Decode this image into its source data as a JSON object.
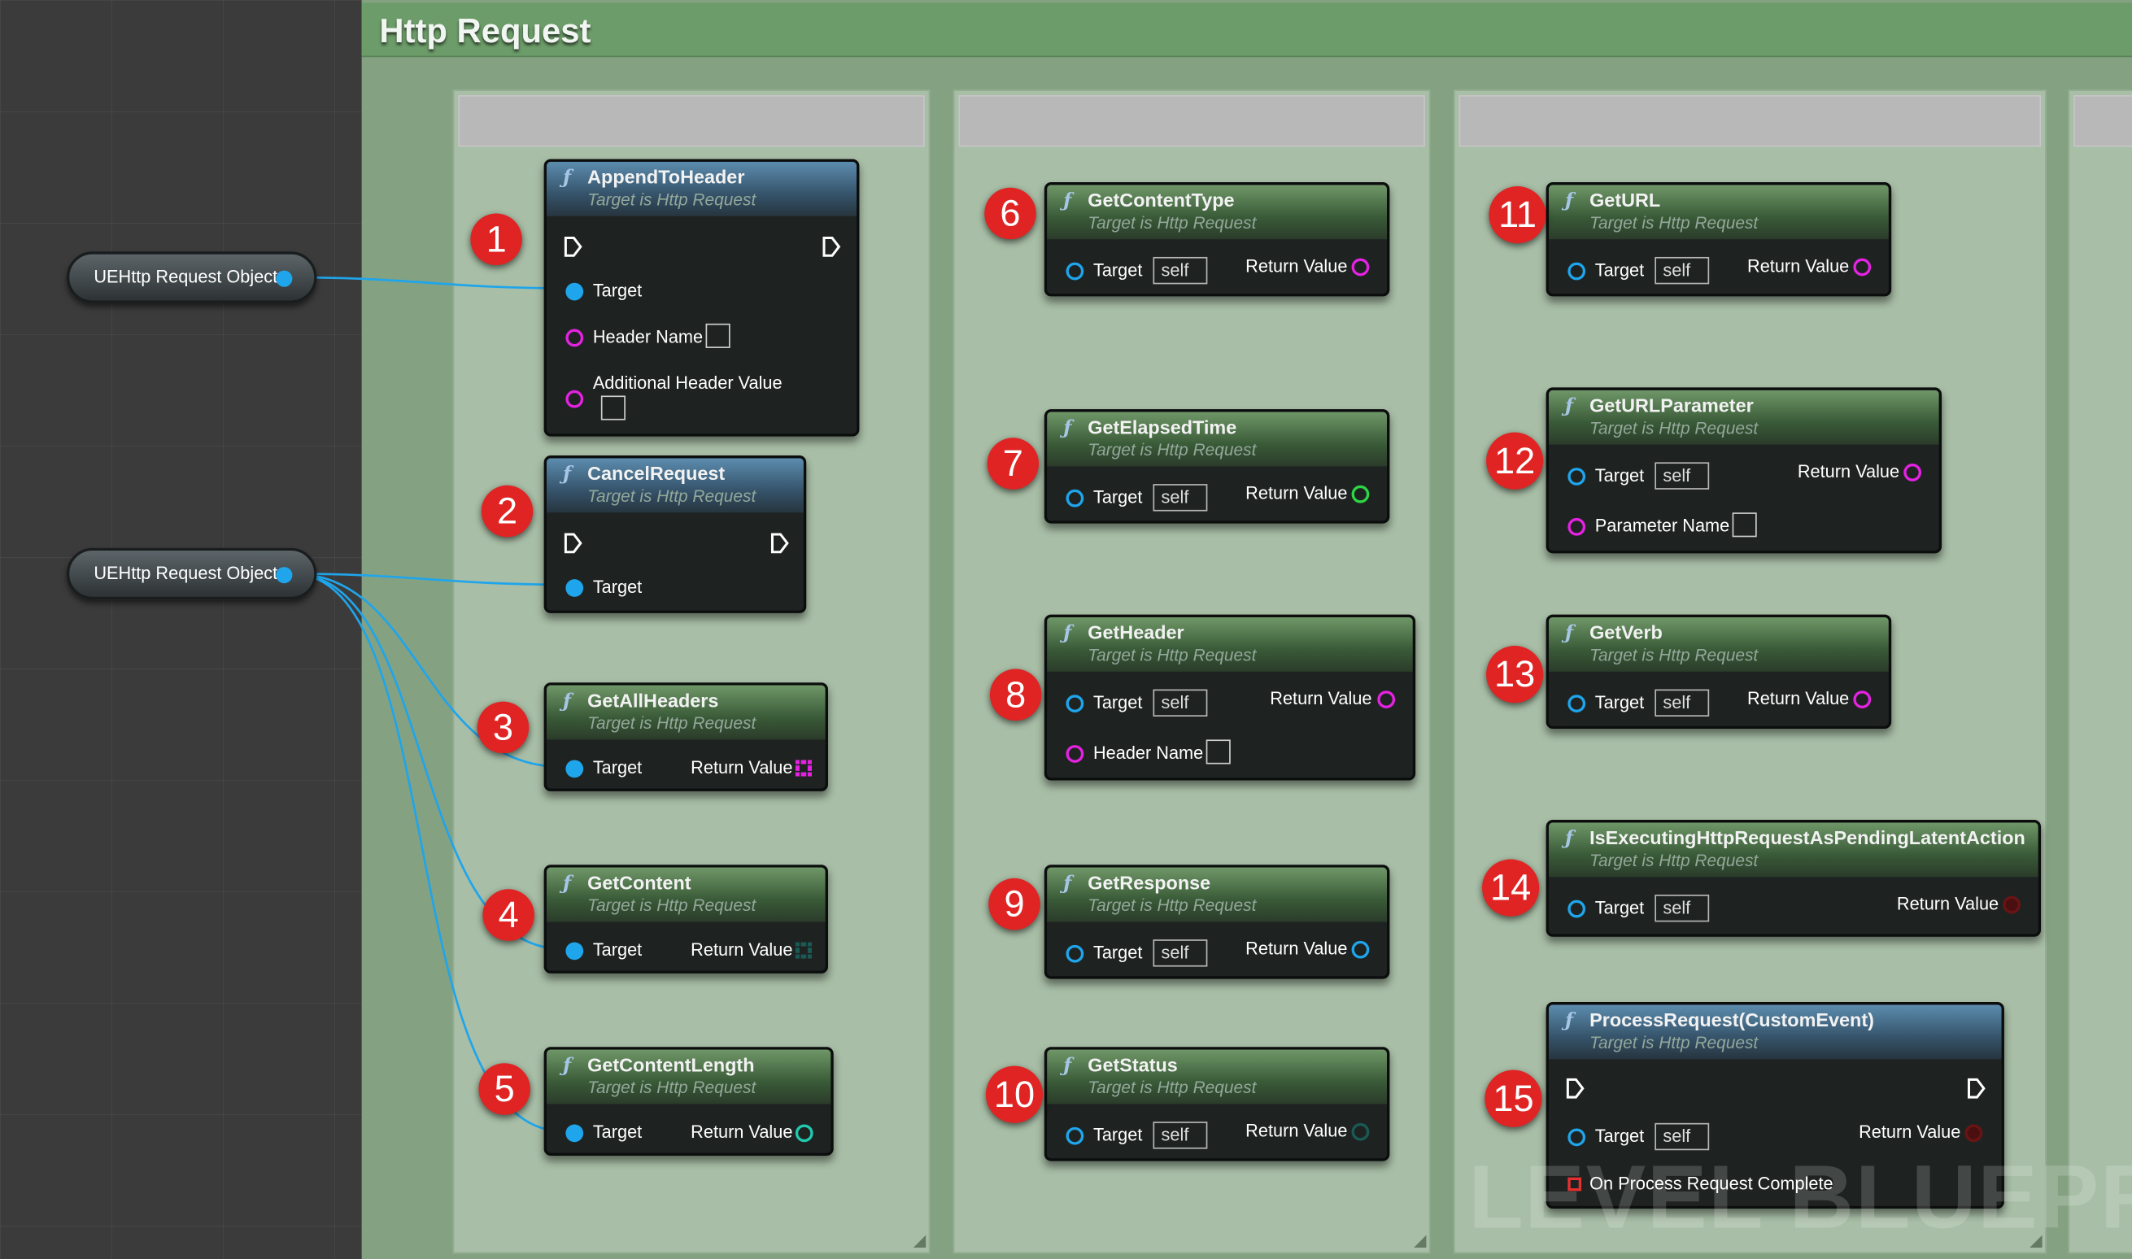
{
  "comment": {
    "title": "Http Request"
  },
  "object_nodes": [
    {
      "label": "UEHttp Request Object"
    },
    {
      "label": "UEHttp Request Object"
    }
  ],
  "common": {
    "target_subtitle": "Target is Http Request",
    "target_label": "Target",
    "self_value": "self",
    "return_value_label": "Return Value"
  },
  "nodes": [
    {
      "number": "1",
      "title": "AppendToHeader",
      "params": [
        "Header Name",
        "Additional Header Value"
      ]
    },
    {
      "number": "2",
      "title": "CancelRequest"
    },
    {
      "number": "3",
      "title": "GetAllHeaders"
    },
    {
      "number": "4",
      "title": "GetContent"
    },
    {
      "number": "5",
      "title": "GetContentLength"
    },
    {
      "number": "6",
      "title": "GetContentType"
    },
    {
      "number": "7",
      "title": "GetElapsedTime"
    },
    {
      "number": "8",
      "title": "GetHeader",
      "params": [
        "Header Name"
      ]
    },
    {
      "number": "9",
      "title": "GetResponse"
    },
    {
      "number": "10",
      "title": "GetStatus"
    },
    {
      "number": "11",
      "title": "GetURL"
    },
    {
      "number": "12",
      "title": "GetURLParameter",
      "params": [
        "Parameter Name"
      ]
    },
    {
      "number": "13",
      "title": "GetVerb"
    },
    {
      "number": "14",
      "title": "IsExecutingHttpRequestAsPendingLatentAction"
    },
    {
      "number": "15",
      "title": "ProcessRequest(CustomEvent)",
      "params": [
        "On Process Request Complete"
      ]
    }
  ],
  "watermark": "LEVEL BLUEPRINT",
  "colors": {
    "object_pin": "#1fa5eb",
    "string_pin": "#e522e2",
    "float_pin": "#2dd645",
    "int_pin": "#21c9b0",
    "badge": "#e02424",
    "comment_bg": "#84a282",
    "comment_title_bar": "#6c9c69"
  }
}
